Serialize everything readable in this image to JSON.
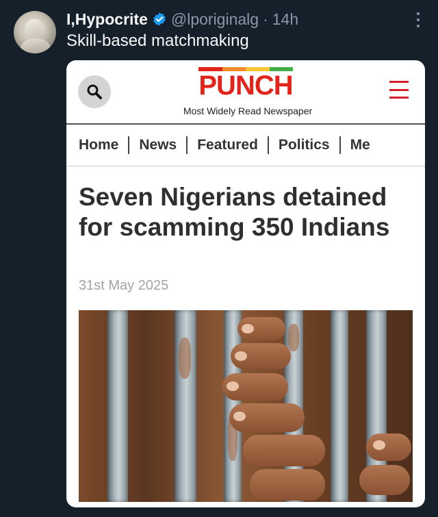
{
  "tweet": {
    "author_name": "I,Hypocrite",
    "handle": "@lporiginalg",
    "separator": "·",
    "time": "14h",
    "text": "Skill-based matchmaking",
    "verified_icon": "verified-badge-icon",
    "verified_color": "#1d9bf0",
    "more_icon": "more-options-icon"
  },
  "card": {
    "logo_text": "PUNCH",
    "logo_color": "#e1251b",
    "logo_bar_colors": [
      "#e1251b",
      "#f28c28",
      "#f7c531",
      "#3fae49"
    ],
    "tagline": "Most Widely Read Newspaper",
    "search_icon": "search-icon",
    "menu_icon": "hamburger-menu-icon",
    "nav_items": [
      "Home",
      "News",
      "Featured",
      "Politics",
      "Me"
    ],
    "headline": "Seven Nigerians detained for scamming 350 Indians",
    "date": "31st May 2025",
    "image_alt": "hands-gripping-prison-bars-photo"
  }
}
